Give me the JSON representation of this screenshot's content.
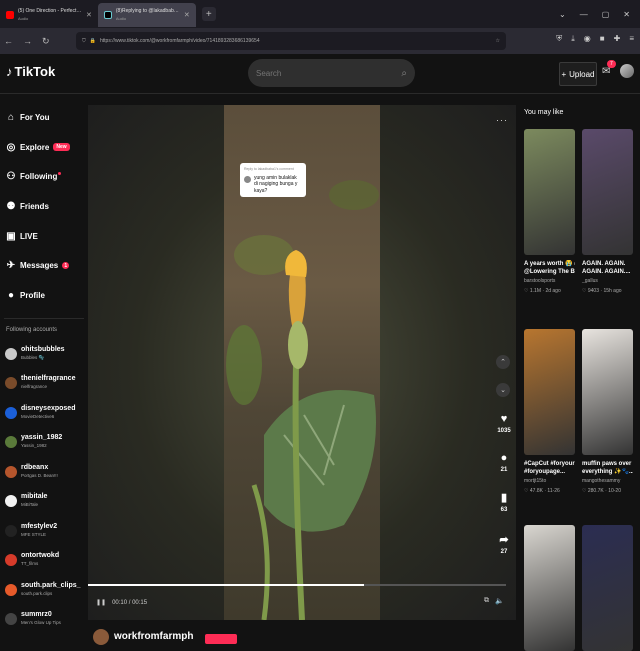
{
  "browser": {
    "tabs": [
      {
        "title": "(5) One Direction - Perfect (Offi",
        "sub": "Audio"
      },
      {
        "title": "(8)Replying to @lakadbaba1 #",
        "sub": "Audio"
      }
    ],
    "url": "https://www.tiktok.com/@workfromfarmph/video/7141893283686139654"
  },
  "header": {
    "logo": "TikTok",
    "search_placeholder": "Search",
    "upload_label": "Upload",
    "inbox_count": "7"
  },
  "sidebar": {
    "items": [
      {
        "label": "For You",
        "icon": "home-icon"
      },
      {
        "label": "Explore",
        "icon": "compass-icon",
        "badge": "New"
      },
      {
        "label": "Following",
        "icon": "following-icon"
      },
      {
        "label": "Friends",
        "icon": "friends-icon"
      },
      {
        "label": "LIVE",
        "icon": "live-icon"
      },
      {
        "label": "Messages",
        "icon": "messages-icon",
        "badge": "1"
      },
      {
        "label": "Profile",
        "icon": "profile-icon"
      }
    ],
    "following_title": "Following accounts",
    "accounts": [
      {
        "name": "ohitsbubbles",
        "sub": "Bubbles 🫧",
        "color": "#c9c9c9"
      },
      {
        "name": "thenielfragrance",
        "sub": "nielfragrance",
        "color": "#7a4b2a"
      },
      {
        "name": "disneysexposed",
        "sub": "MovieDetective6",
        "color": "#1b5fd8"
      },
      {
        "name": "yassin_1982",
        "sub": "Yassin_1982",
        "color": "#5a7a3a"
      },
      {
        "name": "rdbeanx",
        "sub": "Portgas D. Bean!!!",
        "color": "#b5552c"
      },
      {
        "name": "mibitale",
        "sub": "MiBiTale",
        "color": "#f2f2f2"
      },
      {
        "name": "mfestylev2",
        "sub": "MFE STYLE",
        "color": "#222222"
      },
      {
        "name": "ontortwokd",
        "sub": "TT_films",
        "color": "#d63b2a"
      },
      {
        "name": "south.park_clips_",
        "sub": "south.park.clips",
        "color": "#e65a2a"
      },
      {
        "name": "summrz0",
        "sub": "Men's Glow Up Tips",
        "color": "#444444"
      }
    ]
  },
  "player": {
    "comment_reply": "Reply to lakadbaba1's comment",
    "comment_text": "yung amin bulaklak di nagiging bunga y kaya?",
    "time": "00:10 / 00:15",
    "progress": 0.66,
    "likes": "1035",
    "comments": "21",
    "saves": "63",
    "shares": "27",
    "author": "workfromfarmph"
  },
  "you_may_like": {
    "title": "You may like",
    "cards": [
      {
        "caption": "A years worth 😭 #...",
        "caption2": "@Lowering The Bar...",
        "author": "barstoolsports",
        "likes": "1.1M",
        "date": "2d ago",
        "color": "#7c8a5e"
      },
      {
        "caption": "AGAIN. AGAIN.",
        "caption2": "AGAIN. AGAIN....",
        "author": "_gallus",
        "likes": "9403",
        "date": "15h ago",
        "color": "#5a4a6a"
      },
      {
        "caption": "#CapCut #foryour",
        "caption2": "#foryoupage...",
        "author": "mortjt15to",
        "likes": "47.8K",
        "date": "11-26",
        "color": "#b8762f"
      },
      {
        "caption": "muffin paws over",
        "caption2": "everything ✨🐾...",
        "author": "mangothesammy",
        "likes": "280.7K",
        "date": "10-20",
        "color": "#e8e4df"
      },
      {
        "caption": "",
        "caption2": "",
        "author": "",
        "likes": "",
        "date": "",
        "color": "#d9d6d0"
      },
      {
        "caption": "",
        "caption2": "",
        "author": "",
        "likes": "",
        "date": "",
        "color": "#2b2d52"
      }
    ]
  }
}
